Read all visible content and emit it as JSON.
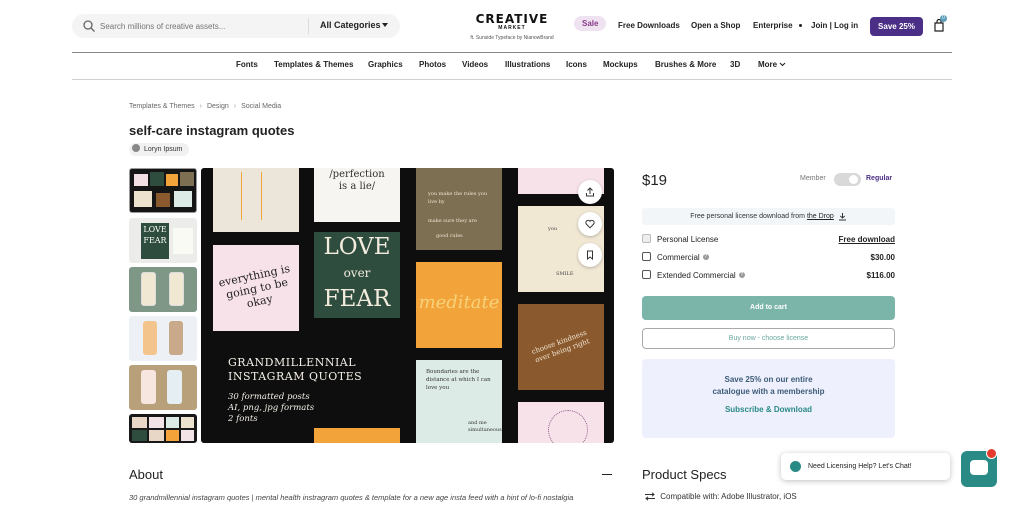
{
  "header": {
    "search_placeholder": "Search millions of creative assets...",
    "category_label": "All Categories",
    "logo_line1": "CREATIVE",
    "logo_line2": "MARKET",
    "logo_tagline": "ft. Sunside Typeface by NianowBrand",
    "sale_label": "Sale",
    "free_downloads": "Free Downloads",
    "open_shop": "Open a Shop",
    "enterprise": "Enterprise",
    "join_login": "Join | Log in",
    "save_button": "Save 25%",
    "cart_count": "0"
  },
  "categories": [
    "Fonts",
    "Templates & Themes",
    "Graphics",
    "Photos",
    "Videos",
    "Illustrations",
    "Icons",
    "Mockups",
    "Brushes & More",
    "3D",
    "More"
  ],
  "breadcrumb": [
    "Templates & Themes",
    "Design",
    "Social Media"
  ],
  "product": {
    "title": "self-care instagram quotes",
    "author": "Loryn Ipsum"
  },
  "preview": {
    "love": "LOVE",
    "over": "over",
    "fear": "FEAR",
    "perfection": "/perfection\nis a lie/",
    "everything": "everything is going to be okay",
    "meditate": "meditate",
    "grand1": "GRANDMILLENNIAL",
    "grand2": "INSTAGRAM QUOTES",
    "feat1": "30 formatted posts",
    "feat2": "AI, png, jpg formats",
    "feat3": "2 fonts",
    "boundaries": "Boundaries are the distance at which I can love you",
    "and_me": "and me simultaneously.",
    "choose": "choose kindness over being right",
    "tan_top": "you make the rules you live by",
    "tan_mid": "make sure they are",
    "tan_bot": "good rules",
    "you": "you",
    "smile": "SMILE",
    "thumb_love": "LOVE",
    "thumb_fear": "FEAR"
  },
  "pricing": {
    "price": "$19",
    "member_label": "Member",
    "regular_label": "Regular",
    "free_license_text": "Free personal license download from",
    "the_drop": "the Drop",
    "licenses": [
      {
        "name": "Personal License",
        "price": "Free download"
      },
      {
        "name": "Commercial",
        "price": "$30.00"
      },
      {
        "name": "Extended Commercial",
        "price": "$116.00"
      }
    ],
    "add_to_cart": "Add to cart",
    "buy_now": "Buy now - choose license",
    "promo_line1": "Save 25% on our entire",
    "promo_line2": "catalogue with a membership",
    "promo_cta": "Subscribe & Download"
  },
  "about": {
    "heading": "About",
    "text": "30 grandmillennial instagram quotes | mental health instragram quotes & template for a new age insta feed with a hint of lo-fi nostalgia"
  },
  "specs": {
    "heading": "Product Specs",
    "compatible": "Compatible with: Adobe Illustrator, iOS"
  },
  "chat": {
    "prompt": "Need Licensing Help? Let's Chat!"
  },
  "colors": {
    "accent": "#4b2f86",
    "teal": "#7bb5aa",
    "sale_bg": "#efe3f2"
  }
}
